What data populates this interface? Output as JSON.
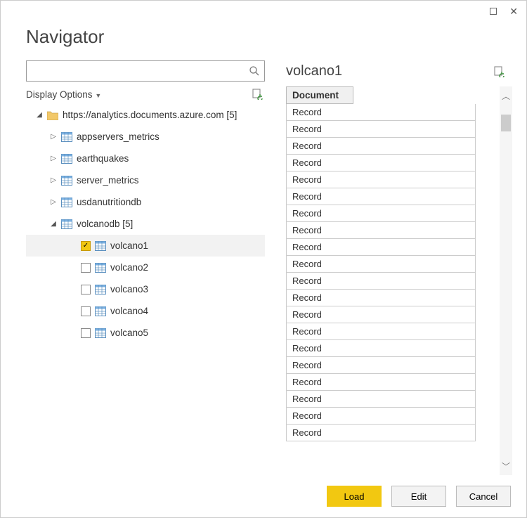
{
  "window": {
    "title": "Navigator"
  },
  "search": {
    "placeholder": ""
  },
  "options": {
    "label": "Display Options"
  },
  "tree": {
    "root": {
      "label": "https://analytics.documents.azure.com [5]"
    },
    "databases": [
      {
        "label": "appservers_metrics"
      },
      {
        "label": "earthquakes"
      },
      {
        "label": "server_metrics"
      },
      {
        "label": "usdanutritiondb"
      }
    ],
    "expandedDb": {
      "label": "volcanodb [5]"
    },
    "collections": [
      {
        "label": "volcano1",
        "checked": true
      },
      {
        "label": "volcano2",
        "checked": false
      },
      {
        "label": "volcano3",
        "checked": false
      },
      {
        "label": "volcano4",
        "checked": false
      },
      {
        "label": "volcano5",
        "checked": false
      }
    ]
  },
  "preview": {
    "title": "volcano1",
    "columnHeader": "Document",
    "rows": [
      "Record",
      "Record",
      "Record",
      "Record",
      "Record",
      "Record",
      "Record",
      "Record",
      "Record",
      "Record",
      "Record",
      "Record",
      "Record",
      "Record",
      "Record",
      "Record",
      "Record",
      "Record",
      "Record",
      "Record"
    ]
  },
  "buttons": {
    "load": "Load",
    "edit": "Edit",
    "cancel": "Cancel"
  }
}
